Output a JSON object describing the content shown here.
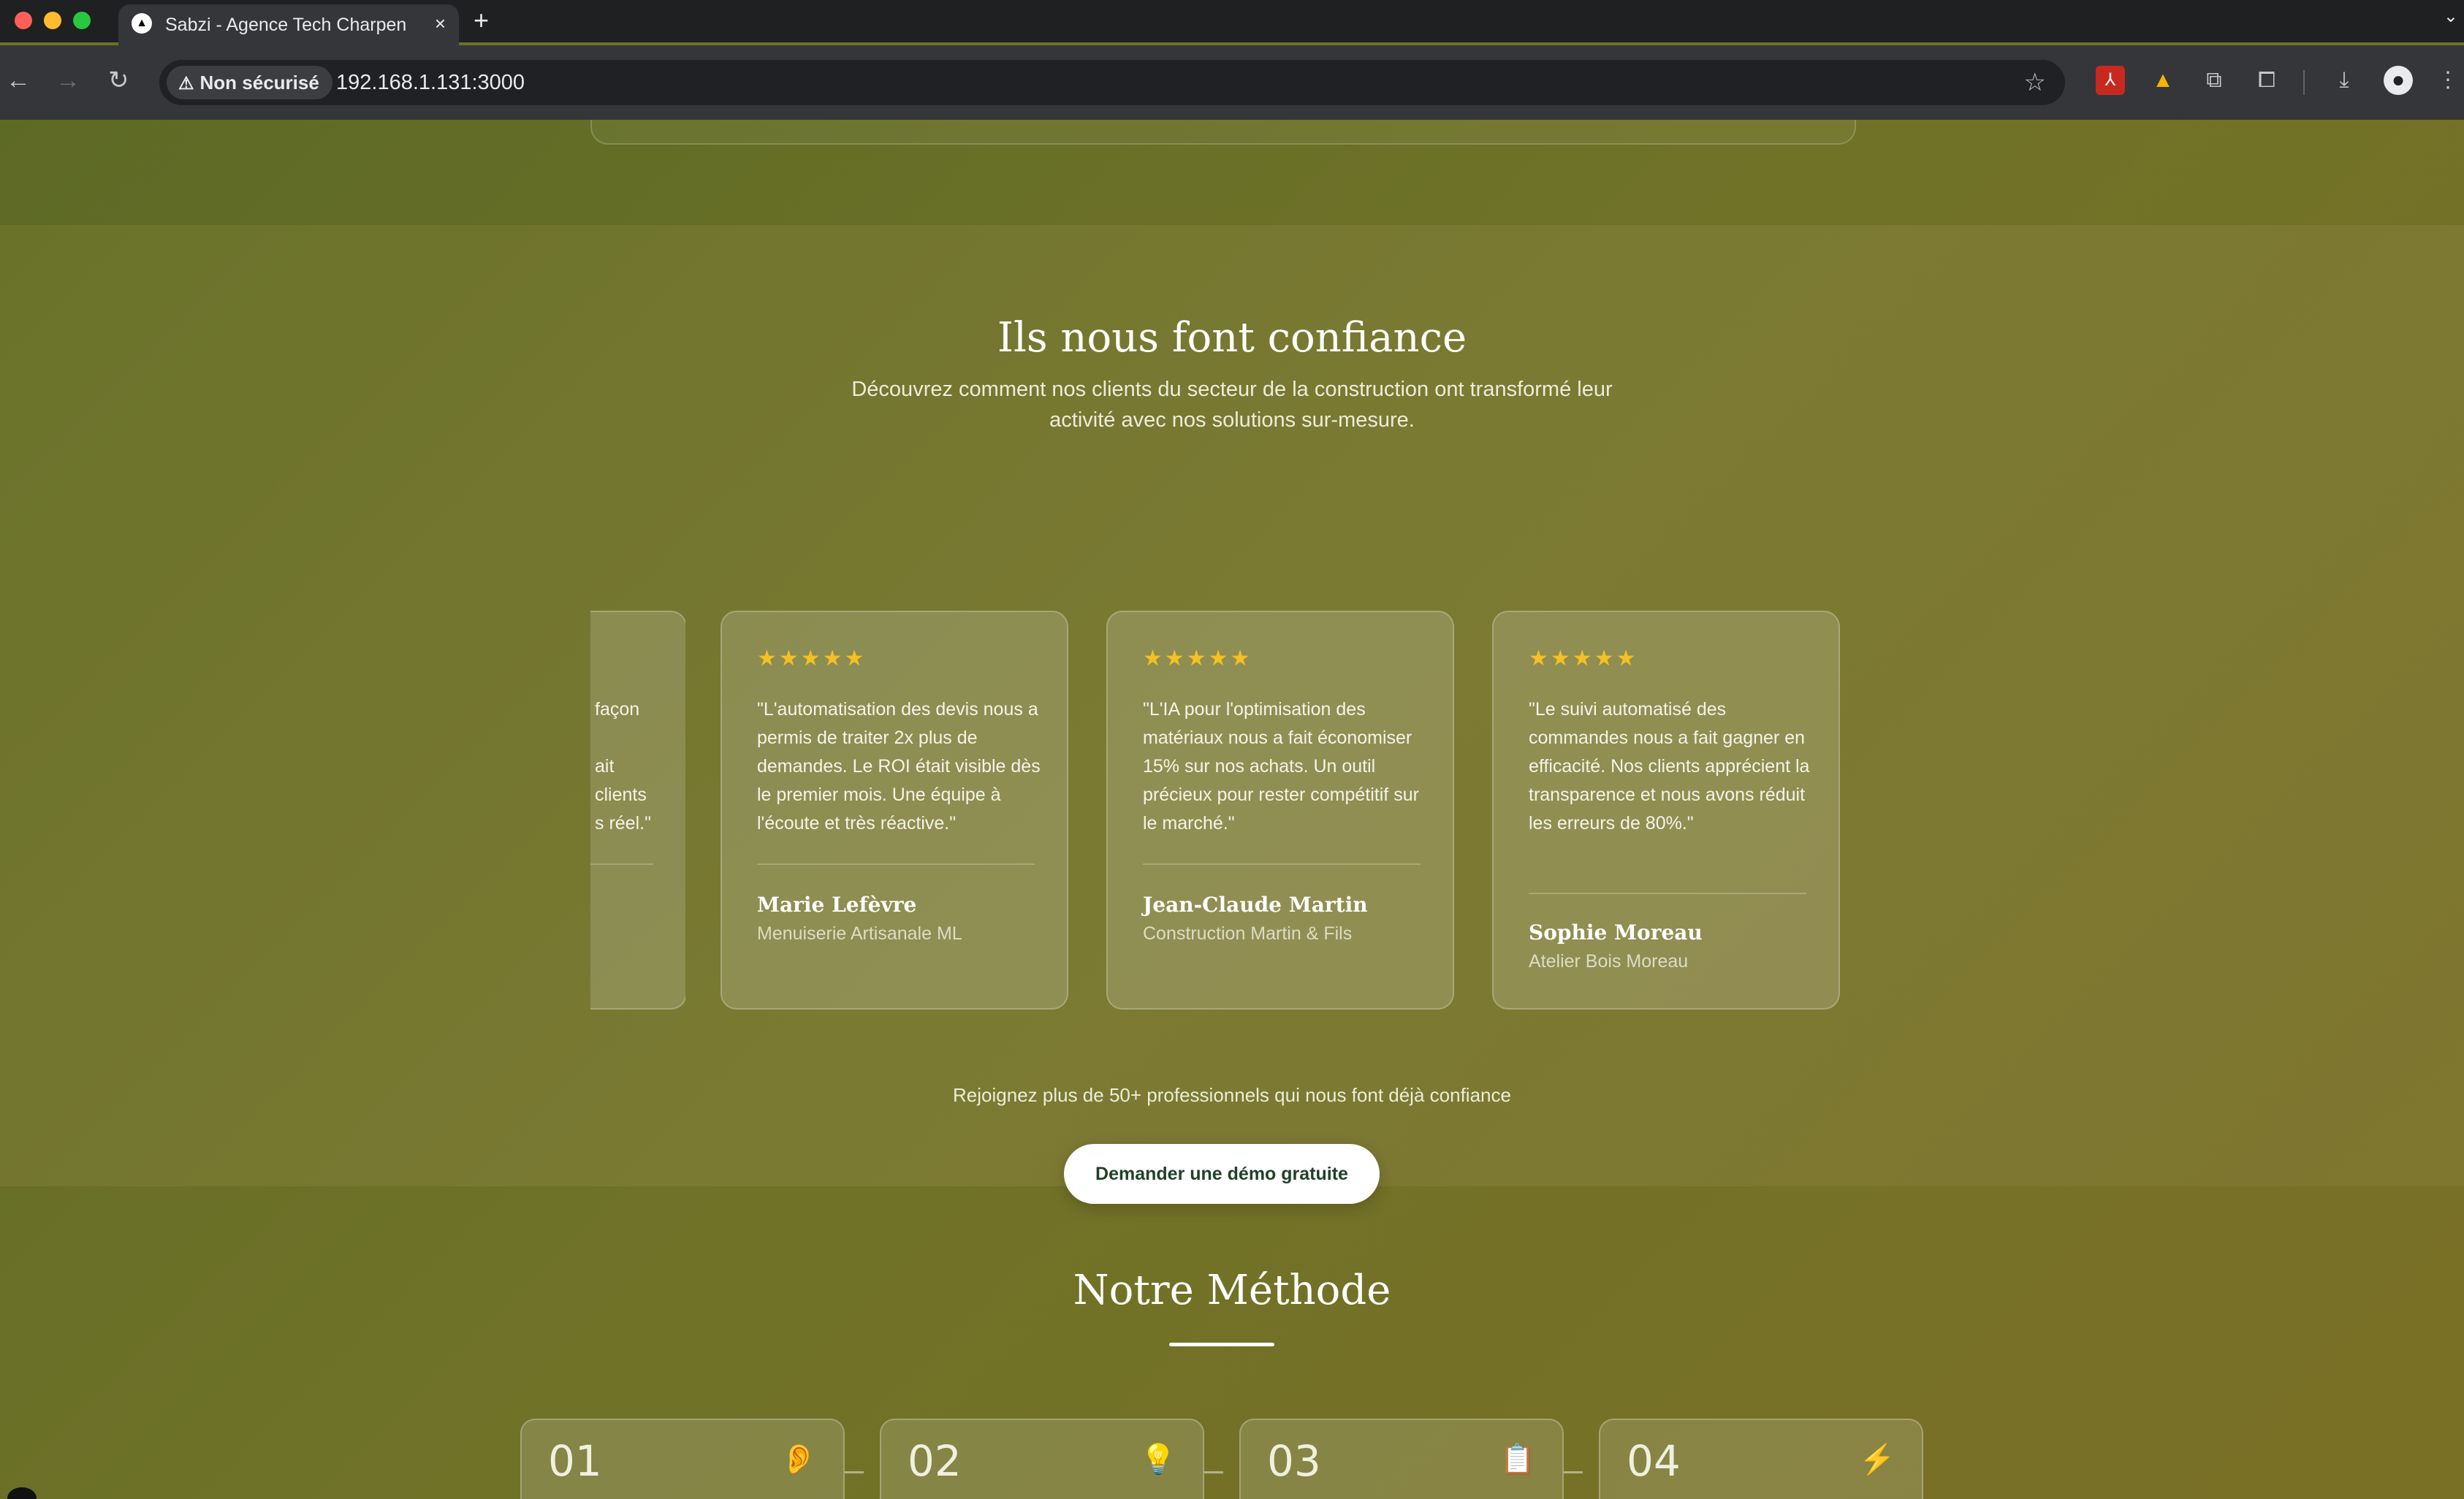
{
  "browser": {
    "tab_title": "Sabzi - Agence Tech Charpente",
    "tab_close": "×",
    "new_tab": "+",
    "security_label": "Non sécurisé",
    "url": "192.168.1.131:3000"
  },
  "testimonials": {
    "title": "Ils nous font confiance",
    "subtitle": "Découvrez comment nos clients du secteur de la construction ont transformé leur activité avec nos solutions sur-mesure.",
    "stars": "★★★★★",
    "partial_card": {
      "quote_fragments": [
        "façon",
        "",
        "ait",
        "clients",
        "s réel.\""
      ]
    },
    "items": [
      {
        "quote": "\"L'automatisation des devis nous a permis de traiter 2x plus de demandes. Le ROI était visible dès le premier mois. Une équipe à l'écoute et très réactive.\"",
        "name": "Marie Lefèvre",
        "company": "Menuiserie Artisanale ML",
        "rating": 5
      },
      {
        "quote": "\"L'IA pour l'optimisation des matériaux nous a fait économiser 15% sur nos achats. Un outil précieux pour rester compétitif sur le marché.\"",
        "name": "Jean-Claude Martin",
        "company": "Construction Martin & Fils",
        "rating": 5
      },
      {
        "quote": "\"Le suivi automatisé des commandes nous a fait gagner en efficacité. Nos clients apprécient la transparence et nous avons réduit les erreurs de 80%.\"",
        "name": "Sophie Moreau",
        "company": "Atelier Bois Moreau",
        "rating": 5
      }
    ],
    "join_text": "Rejoignez plus de 50+ professionnels qui nous font déjà confiance",
    "cta_label": "Demander une démo gratuite"
  },
  "method": {
    "title": "Notre Méthode",
    "steps": [
      {
        "number": "01",
        "icon": "ear-icon",
        "glyph": "👂"
      },
      {
        "number": "02",
        "icon": "lightbulb-icon",
        "glyph": "💡"
      },
      {
        "number": "03",
        "icon": "clipboard-icon",
        "glyph": "📋"
      },
      {
        "number": "04",
        "icon": "lightning-icon",
        "glyph": "⚡"
      }
    ]
  },
  "colors": {
    "background": "#6e7128",
    "star": "#f4c026",
    "cta_text": "#22402a"
  }
}
